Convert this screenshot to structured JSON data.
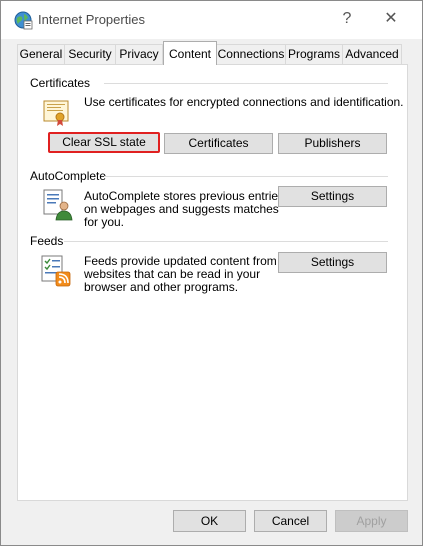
{
  "window": {
    "title": "Internet Properties",
    "help_glyph": "?",
    "close_glyph": "✕"
  },
  "tabs": [
    {
      "label": "General"
    },
    {
      "label": "Security"
    },
    {
      "label": "Privacy"
    },
    {
      "label": "Content",
      "active": true
    },
    {
      "label": "Connections"
    },
    {
      "label": "Programs"
    },
    {
      "label": "Advanced"
    }
  ],
  "certificates": {
    "group_label": "Certificates",
    "description": "Use certificates for encrypted connections and identification.",
    "clear_ssl_label": "Clear SSL state",
    "certificates_label": "Certificates",
    "publishers_label": "Publishers"
  },
  "autocomplete": {
    "group_label": "AutoComplete",
    "description_lines": [
      "AutoComplete stores previous entries",
      "on webpages and suggests matches",
      "for you."
    ],
    "settings_label": "Settings"
  },
  "feeds": {
    "group_label": "Feeds",
    "description_lines": [
      "Feeds provide updated content from",
      "websites that can be read in your",
      "browser and other programs."
    ],
    "settings_label": "Settings"
  },
  "footer": {
    "ok_label": "OK",
    "cancel_label": "Cancel",
    "apply_label": "Apply"
  },
  "colors": {
    "highlight": "#e02020",
    "button_face": "#e1e1e1",
    "dialog_bg": "#f0f0f0"
  }
}
